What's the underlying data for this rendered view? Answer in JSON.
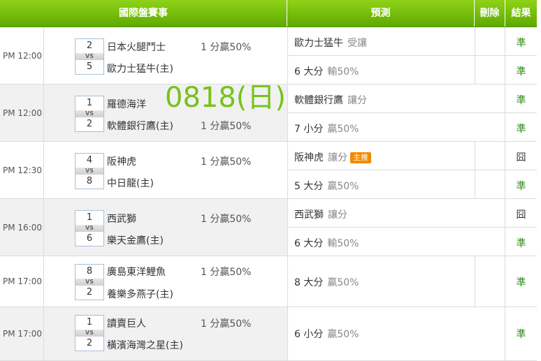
{
  "header": {
    "col_match": "國際盤賽事",
    "col_predict": "預測",
    "col_delete": "刪除",
    "col_result": "結果"
  },
  "date_label": "0818(日)",
  "vs_label": "VS",
  "rows": [
    {
      "time": "PM 12:00",
      "away_score": "2",
      "away_team": "日本火腿鬥士",
      "home_score": "5",
      "home_team": "歐力士猛牛(主)",
      "away_odds": "1 分贏50%",
      "home_odds": "",
      "pred1_main": "歐力士猛牛",
      "pred1_sub": "受讓",
      "pred1_result": "準",
      "pred2_main": "6 大分",
      "pred2_sub": "輸50%",
      "pred2_result": "準"
    },
    {
      "time": "PM 12:00",
      "away_score": "1",
      "away_team": "羅德海洋",
      "home_score": "2",
      "home_team": "軟體銀行鷹(主)",
      "away_odds": "",
      "home_odds": "1 分贏50%",
      "pred1_main": "軟體銀行鷹",
      "pred1_sub": "讓分",
      "pred1_result": "準",
      "pred2_main": "7 小分",
      "pred2_sub": "贏50%",
      "pred2_result": "準"
    },
    {
      "time": "PM 12:30",
      "away_score": "4",
      "away_team": "阪神虎",
      "home_score": "8",
      "home_team": "中日龍(主)",
      "away_odds": "1 分贏50%",
      "home_odds": "",
      "pred1_main": "阪神虎",
      "pred1_sub": "讓分",
      "pred1_badge": "主推",
      "pred1_result": "囧",
      "pred2_main": "5 大分",
      "pred2_sub": "贏50%",
      "pred2_result": "準"
    },
    {
      "time": "PM 16:00",
      "away_score": "1",
      "away_team": "西武獅",
      "home_score": "6",
      "home_team": "樂天金鷹(主)",
      "away_odds": "1 分贏50%",
      "home_odds": "",
      "pred1_main": "西武獅",
      "pred1_sub": "讓分",
      "pred1_result": "囧",
      "pred2_main": "6 大分",
      "pred2_sub": "輸50%",
      "pred2_result": "準"
    },
    {
      "time": "PM 17:00",
      "away_score": "8",
      "away_team": "廣島東洋鯉魚",
      "home_score": "2",
      "home_team": "養樂多燕子(主)",
      "away_odds": "1 分贏50%",
      "home_odds": "",
      "pred_main": "8 大分",
      "pred_sub": "贏50%",
      "pred_result": "準"
    },
    {
      "time": "PM 17:00",
      "away_score": "1",
      "away_team": "讀賣巨人",
      "home_score": "2",
      "home_team": "橫濱海灣之星(主)",
      "away_odds": "1 分贏50%",
      "home_odds": "",
      "pred_main": "6 小分",
      "pred_sub": "贏50%",
      "pred_result": "準"
    }
  ],
  "colors": {
    "header_green": "#6db80c",
    "result_green": "#2e8b1a",
    "date_green": "#76c21a",
    "badge_orange": "#f08a00"
  }
}
